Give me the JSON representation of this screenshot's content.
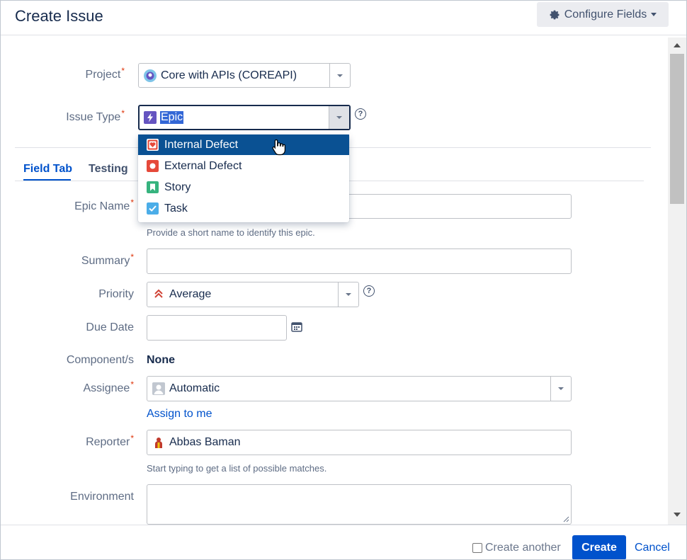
{
  "header": {
    "title": "Create Issue",
    "configure_label": "Configure Fields"
  },
  "fields": {
    "project": {
      "label": "Project",
      "value": "Core with APIs (COREAPI)"
    },
    "issue_type": {
      "label": "Issue Type",
      "value": "Epic"
    },
    "epic_name": {
      "label": "Epic Name",
      "hint": "Provide a short name to identify this epic."
    },
    "summary": {
      "label": "Summary"
    },
    "priority": {
      "label": "Priority",
      "value": "Average"
    },
    "due_date": {
      "label": "Due Date"
    },
    "components": {
      "label": "Component/s",
      "value": "None"
    },
    "assignee": {
      "label": "Assignee",
      "value": "Automatic",
      "assign_link": "Assign to me"
    },
    "reporter": {
      "label": "Reporter",
      "value": "Abbas Baman",
      "hint": "Start typing to get a list of possible matches."
    },
    "environment": {
      "label": "Environment"
    }
  },
  "required_marker": "*",
  "help_glyph": "?",
  "tabs": [
    {
      "label": "Field Tab",
      "active": true
    },
    {
      "label": "Testing",
      "active": false
    }
  ],
  "issue_type_dropdown": {
    "items": [
      {
        "label": "Internal Defect",
        "icon": "internal-defect-icon",
        "highlighted": true
      },
      {
        "label": "External Defect",
        "icon": "external-defect-icon",
        "highlighted": false
      },
      {
        "label": "Story",
        "icon": "story-icon",
        "highlighted": false
      },
      {
        "label": "Task",
        "icon": "task-icon",
        "highlighted": false
      }
    ]
  },
  "footer": {
    "create_another": "Create another",
    "create": "Create",
    "cancel": "Cancel"
  },
  "colors": {
    "accent": "#0052cc",
    "highlight": "#0a5193",
    "required": "#de350b",
    "epic": "#6554c0",
    "story": "#36b37e",
    "task": "#4bade8",
    "defect": "#e5493a"
  }
}
